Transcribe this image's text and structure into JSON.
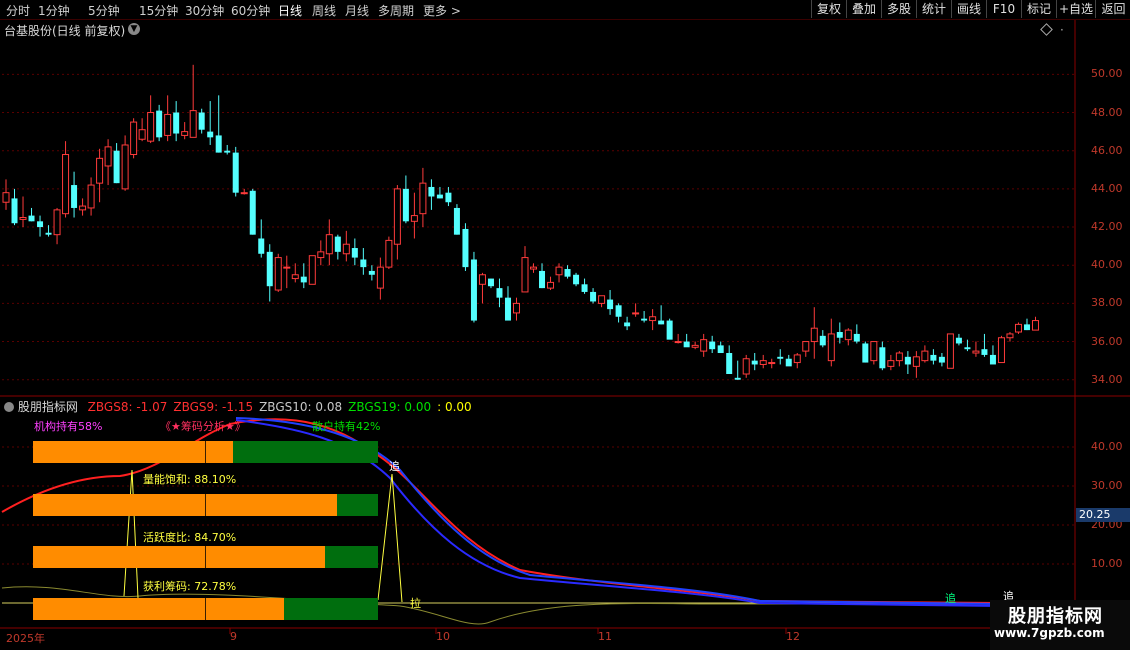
{
  "toolbar": {
    "timeframes": [
      "分时",
      "1分钟",
      "5分钟",
      "15分钟",
      "30分钟",
      "60分钟",
      "日线",
      "周线",
      "月线",
      "多周期",
      "更多 >"
    ],
    "active_timeframe": "日线",
    "buttons": [
      "复权",
      "叠加",
      "多股",
      "统计",
      "画线",
      "F10",
      "+自选",
      "返回"
    ],
    "extra_button": "标记"
  },
  "stock": {
    "title": "台基股份(日线 前复权)"
  },
  "price_axis": {
    "ticks": [
      "50.00",
      "48.00",
      "46.00",
      "44.00",
      "42.00",
      "40.00",
      "38.00",
      "36.00",
      "34.00"
    ]
  },
  "indicator": {
    "name": "股朋指标网",
    "values": [
      {
        "label": "ZBGS8: -1.07",
        "color": "#ff3030"
      },
      {
        "label": "ZBGS9: -1.15",
        "color": "#ff3030"
      },
      {
        "label": "ZBGS10: 0.08",
        "color": "#c8c8c8"
      },
      {
        "label": "ZBGS19: 0.00",
        "color": "#00e000"
      },
      {
        "label": ": 0.00",
        "color": "#ffff00"
      }
    ],
    "inst_label": "机构持有58%",
    "analysis_label": "《★筹码分析★》",
    "retail_label": "散户持有42%",
    "metrics": [
      {
        "label": "量能饱和:  88.10%",
        "value": 0.881
      },
      {
        "label": "活跃度比:  84.70%",
        "value": 0.847
      },
      {
        "label": "获利筹码:  72.78%",
        "value": 0.7278
      }
    ],
    "holding_split": 0.58,
    "axis_ticks": [
      "40.00",
      "30.00",
      "20.00",
      "10.00"
    ],
    "current_value": "20.25",
    "signals": {
      "zhui": "追",
      "la": "拉",
      "zhui2": "追",
      "zhui3": "追"
    }
  },
  "x_axis": {
    "labels": [
      "2025年",
      "9",
      "10",
      "11",
      "12"
    ]
  },
  "watermark": {
    "line1": "股朋指标网",
    "line2": "www.7gpzb.com"
  },
  "chart_data": {
    "type": "candlestick",
    "title": "台基股份(日线 前复权)",
    "ylim": [
      33.2,
      51.8
    ],
    "up_color": "#ff3b3b",
    "down_color": "#54ffff",
    "ohlc": [
      [
        43.3,
        44.5,
        42.9,
        43.8
      ],
      [
        43.5,
        44.0,
        42.1,
        42.2
      ],
      [
        42.4,
        43.6,
        42.0,
        42.5
      ],
      [
        42.6,
        43.0,
        42.3,
        42.3
      ],
      [
        42.3,
        42.6,
        41.5,
        42.0
      ],
      [
        41.7,
        42.1,
        41.5,
        41.6
      ],
      [
        41.6,
        43.0,
        41.1,
        42.9
      ],
      [
        42.7,
        46.5,
        42.5,
        45.8
      ],
      [
        44.2,
        44.9,
        42.5,
        43.0
      ],
      [
        42.9,
        43.5,
        42.6,
        43.1
      ],
      [
        43.0,
        44.6,
        42.6,
        44.2
      ],
      [
        44.3,
        46.1,
        43.3,
        45.6
      ],
      [
        45.2,
        46.6,
        44.2,
        46.2
      ],
      [
        46.0,
        46.4,
        44.3,
        44.3
      ],
      [
        44.0,
        46.8,
        43.9,
        46.3
      ],
      [
        45.8,
        47.7,
        45.6,
        47.5
      ],
      [
        46.6,
        47.7,
        46.5,
        47.1
      ],
      [
        46.5,
        48.9,
        46.4,
        48.0
      ],
      [
        48.1,
        48.4,
        46.5,
        46.7
      ],
      [
        46.8,
        48.9,
        46.5,
        47.9
      ],
      [
        48.0,
        48.6,
        46.5,
        46.9
      ],
      [
        46.8,
        47.5,
        46.6,
        47.0
      ],
      [
        46.7,
        50.5,
        46.7,
        48.1
      ],
      [
        48.0,
        48.2,
        46.9,
        47.1
      ],
      [
        47.0,
        48.6,
        46.3,
        46.7
      ],
      [
        46.8,
        48.9,
        45.9,
        45.9
      ],
      [
        46.0,
        46.3,
        45.8,
        45.9
      ],
      [
        45.9,
        46.2,
        43.6,
        43.8
      ],
      [
        43.8,
        44.0,
        43.7,
        43.8
      ],
      [
        43.9,
        44.0,
        41.6,
        41.6
      ],
      [
        41.4,
        42.4,
        40.4,
        40.6
      ],
      [
        40.7,
        41.1,
        38.1,
        38.9
      ],
      [
        38.7,
        40.6,
        38.6,
        40.4
      ],
      [
        39.9,
        40.5,
        38.8,
        39.9
      ],
      [
        39.3,
        40.1,
        39.1,
        39.5
      ],
      [
        39.4,
        40.1,
        38.8,
        39.1
      ],
      [
        39.0,
        40.5,
        39.0,
        40.5
      ],
      [
        40.4,
        41.3,
        40.0,
        40.7
      ],
      [
        40.6,
        42.4,
        40.0,
        41.6
      ],
      [
        41.5,
        41.6,
        40.3,
        40.7
      ],
      [
        40.6,
        41.8,
        40.2,
        41.1
      ],
      [
        40.9,
        41.4,
        40.0,
        40.4
      ],
      [
        40.3,
        40.9,
        39.5,
        39.9
      ],
      [
        39.7,
        40.0,
        39.2,
        39.5
      ],
      [
        38.8,
        40.4,
        38.2,
        39.9
      ],
      [
        39.9,
        41.5,
        39.8,
        41.3
      ],
      [
        41.1,
        44.2,
        40.3,
        44.0
      ],
      [
        44.0,
        44.7,
        42.2,
        42.3
      ],
      [
        42.3,
        43.8,
        41.4,
        42.6
      ],
      [
        42.7,
        45.1,
        42.0,
        44.3
      ],
      [
        44.1,
        44.5,
        42.9,
        43.6
      ],
      [
        43.7,
        44.1,
        43.5,
        43.5
      ],
      [
        43.8,
        44.1,
        43.1,
        43.3
      ],
      [
        43.0,
        43.2,
        41.6,
        41.6
      ],
      [
        41.9,
        42.2,
        39.7,
        39.9
      ],
      [
        40.3,
        40.7,
        37.0,
        37.1
      ],
      [
        39.0,
        39.6,
        38.0,
        39.5
      ],
      [
        39.3,
        39.3,
        38.8,
        38.9
      ],
      [
        38.8,
        39.3,
        37.8,
        38.3
      ],
      [
        38.3,
        38.9,
        37.4,
        37.1
      ],
      [
        37.5,
        38.3,
        37.1,
        38.0
      ],
      [
        38.6,
        41.0,
        38.6,
        40.4
      ],
      [
        39.8,
        40.1,
        39.6,
        39.9
      ],
      [
        39.7,
        40.1,
        38.8,
        38.8
      ],
      [
        38.8,
        39.4,
        38.7,
        39.1
      ],
      [
        39.5,
        40.1,
        39.1,
        39.9
      ],
      [
        39.8,
        40.0,
        39.3,
        39.4
      ],
      [
        39.5,
        39.6,
        38.9,
        39.0
      ],
      [
        39.0,
        39.3,
        38.5,
        38.6
      ],
      [
        38.6,
        38.8,
        38.0,
        38.1
      ],
      [
        38.0,
        38.4,
        37.8,
        38.4
      ],
      [
        38.2,
        38.7,
        37.4,
        37.7
      ],
      [
        37.9,
        38.0,
        37.0,
        37.3
      ],
      [
        37.0,
        37.3,
        36.6,
        36.8
      ],
      [
        37.5,
        38.0,
        37.3,
        37.5
      ],
      [
        37.2,
        37.6,
        37.0,
        37.1
      ],
      [
        37.1,
        37.7,
        36.6,
        37.3
      ],
      [
        37.1,
        37.9,
        36.9,
        36.9
      ],
      [
        37.1,
        37.2,
        36.3,
        36.1
      ],
      [
        36.0,
        36.4,
        35.9,
        36.0
      ],
      [
        36.0,
        36.4,
        35.8,
        35.7
      ],
      [
        35.7,
        36.0,
        35.6,
        35.8
      ],
      [
        35.5,
        36.4,
        35.2,
        36.1
      ],
      [
        36.0,
        36.3,
        35.4,
        35.6
      ],
      [
        35.8,
        36.0,
        35.4,
        35.4
      ],
      [
        35.4,
        35.8,
        34.3,
        34.3
      ],
      [
        34.1,
        35.0,
        34.0,
        34.0
      ],
      [
        34.3,
        35.3,
        34.1,
        35.1
      ],
      [
        35.0,
        35.4,
        34.5,
        34.8
      ],
      [
        34.8,
        35.3,
        34.6,
        35.0
      ],
      [
        34.9,
        35.1,
        34.6,
        34.9
      ],
      [
        35.2,
        35.6,
        34.8,
        35.1
      ],
      [
        35.1,
        35.3,
        34.8,
        34.7
      ],
      [
        34.9,
        35.4,
        34.6,
        35.3
      ],
      [
        35.5,
        36.0,
        35.2,
        36.0
      ],
      [
        36.0,
        37.8,
        35.1,
        36.7
      ],
      [
        36.3,
        36.6,
        35.7,
        35.8
      ],
      [
        35.0,
        37.2,
        34.7,
        36.4
      ],
      [
        36.5,
        37.0,
        35.9,
        36.2
      ],
      [
        36.1,
        36.7,
        35.8,
        36.6
      ],
      [
        36.4,
        36.9,
        35.9,
        36.0
      ],
      [
        35.9,
        36.0,
        34.9,
        34.9
      ],
      [
        35.0,
        36.0,
        34.8,
        36.0
      ],
      [
        35.7,
        36.0,
        34.5,
        34.6
      ],
      [
        34.7,
        35.3,
        34.5,
        35.0
      ],
      [
        35.0,
        35.5,
        34.7,
        35.4
      ],
      [
        35.2,
        35.5,
        34.3,
        34.8
      ],
      [
        34.7,
        35.5,
        34.1,
        35.2
      ],
      [
        35.0,
        35.8,
        34.9,
        35.5
      ],
      [
        35.3,
        35.6,
        34.8,
        35.0
      ],
      [
        35.2,
        35.4,
        34.7,
        34.9
      ],
      [
        34.6,
        36.4,
        34.6,
        36.4
      ],
      [
        36.2,
        36.4,
        35.8,
        35.9
      ],
      [
        35.7,
        36.1,
        35.5,
        35.6
      ],
      [
        35.4,
        36.0,
        35.2,
        35.5
      ],
      [
        35.6,
        36.4,
        35.2,
        35.3
      ],
      [
        35.3,
        35.8,
        34.9,
        34.8
      ],
      [
        34.9,
        36.3,
        34.9,
        36.2
      ],
      [
        36.2,
        36.5,
        36.0,
        36.4
      ],
      [
        36.5,
        37.0,
        36.4,
        36.9
      ],
      [
        36.9,
        37.2,
        36.6,
        36.6
      ],
      [
        36.6,
        37.3,
        36.6,
        37.1
      ]
    ]
  }
}
